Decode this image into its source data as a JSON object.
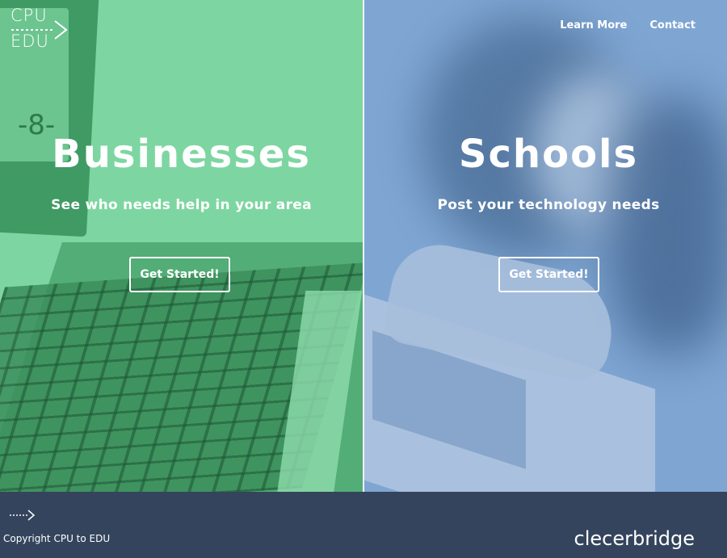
{
  "brand": {
    "logo_line1": "CPU",
    "logo_line2": "EDU"
  },
  "nav": {
    "items": [
      {
        "label": "Learn More"
      },
      {
        "label": "Contact"
      }
    ]
  },
  "panels": {
    "businesses": {
      "title": "Businesses",
      "subtitle": "See who needs help in your area",
      "button": "Get Started!",
      "overlay_color": "#7dd6a1"
    },
    "schools": {
      "title": "Schools",
      "subtitle": "Post your technology needs",
      "button": "Get Started!",
      "overlay_color": "#7fa6d3"
    }
  },
  "footer": {
    "copyright": "Copyright CPU to EDU",
    "cut_off_line": "",
    "sponsor": "clecerbridge",
    "background": "#34445d"
  },
  "icons": [
    "logo-arrow-icon",
    "footer-arrow-icon"
  ]
}
